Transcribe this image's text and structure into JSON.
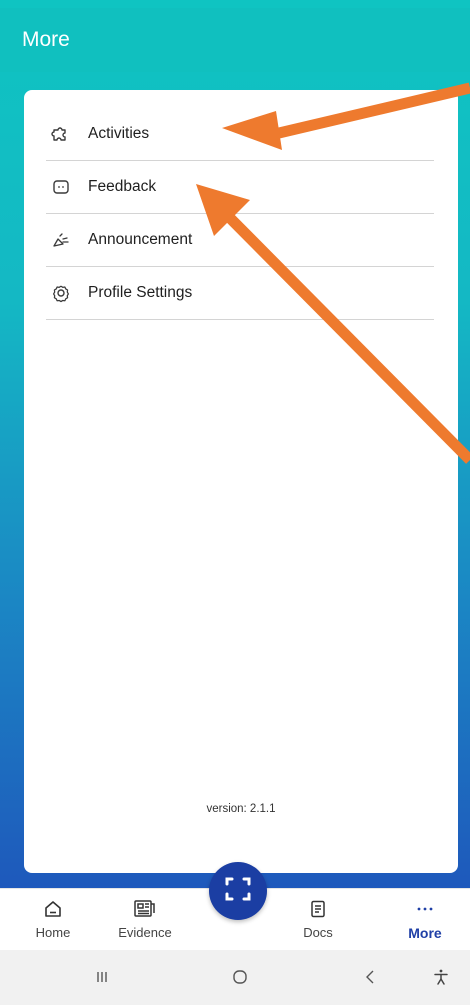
{
  "header": {
    "title": "More"
  },
  "menu": {
    "items": [
      {
        "label": "Activities",
        "icon": "puzzle-icon"
      },
      {
        "label": "Feedback",
        "icon": "chat-bubble-icon"
      },
      {
        "label": "Announcement",
        "icon": "megaphone-icon"
      },
      {
        "label": "Profile Settings",
        "icon": "gear-icon"
      }
    ]
  },
  "footer": {
    "version": "version: 2.1.1"
  },
  "bottom_nav": {
    "items": [
      {
        "label": "Home",
        "icon": "home-icon",
        "active": false
      },
      {
        "label": "Evidence",
        "icon": "newspaper-icon",
        "active": false
      },
      {
        "label": "Docs",
        "icon": "document-icon",
        "active": false
      },
      {
        "label": "More",
        "icon": "more-dots-icon",
        "active": true
      }
    ],
    "fab_icon": "scan-icon"
  },
  "system_nav": {
    "icons": [
      "recent-apps-icon",
      "home-circle-icon",
      "back-icon",
      "accessibility-icon"
    ]
  },
  "colors": {
    "app_bar": "#10c0bf",
    "accent": "#1f3fa6",
    "fab": "#1b3ea3",
    "annotation_arrow": "#ee7a2e"
  }
}
